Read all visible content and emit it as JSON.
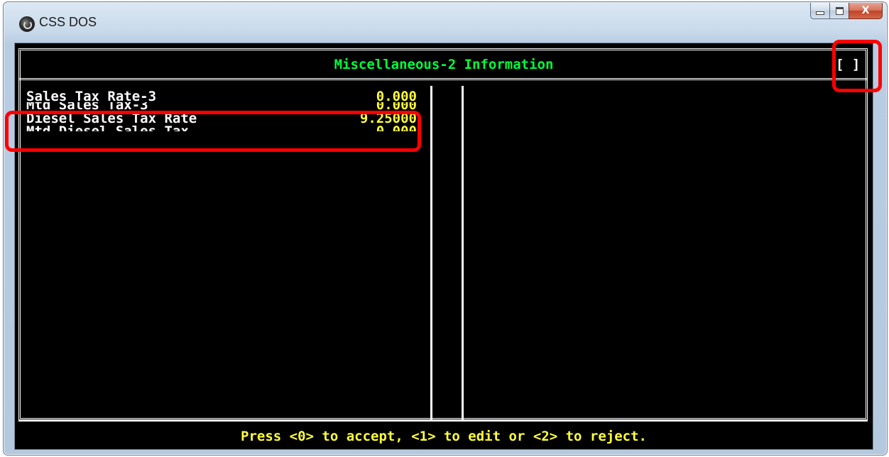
{
  "window": {
    "title": "CSS DOS",
    "caption_close_glyph": "X"
  },
  "screen": {
    "header_title": "Miscellaneous-2 Information",
    "indicator": "[ ]",
    "fields": [
      {
        "label": "Sales Tax Rate-3",
        "value": "0.000"
      },
      {
        "label": "Mtd Sales Tax-3",
        "value": "0.000"
      },
      {
        "label": "Diesel Sales Tax Rate",
        "value": "9.25000"
      },
      {
        "label": "Mtd Diesel Sales Tax",
        "value": "0.000"
      }
    ],
    "prompt": "Press <0> to accept, <1> to edit or <2> to reject."
  },
  "colors": {
    "header_text": "#00ff3c",
    "value_text": "#ffff3c",
    "label_text": "#ffffff",
    "console_bg": "#000000",
    "callout": "#ff0000"
  },
  "icons": {
    "app": "css-dos-app-icon",
    "minimize": "minimize-icon",
    "maximize": "maximize-icon",
    "close": "close-icon"
  }
}
